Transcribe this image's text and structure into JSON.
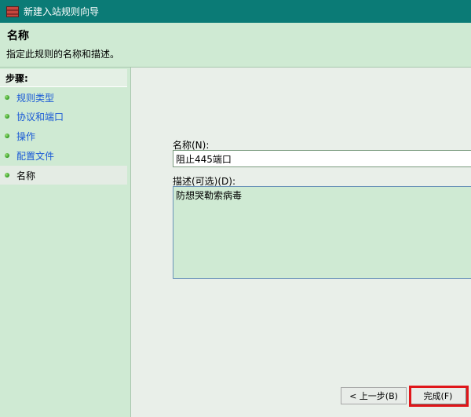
{
  "window": {
    "title": "新建入站规则向导",
    "icon": "firewall-icon"
  },
  "header": {
    "title": "名称",
    "subtitle": "指定此规则的名称和描述。"
  },
  "sidebar": {
    "steps_label": "步骤:",
    "items": [
      {
        "label": "规则类型"
      },
      {
        "label": "协议和端口"
      },
      {
        "label": "操作"
      },
      {
        "label": "配置文件"
      },
      {
        "label": "名称"
      }
    ]
  },
  "form": {
    "name_label": "名称(N):",
    "name_value": "阻止445端口",
    "desc_label": "描述(可选)(D):",
    "desc_value": "防想哭勒索病毒"
  },
  "buttons": {
    "back": "< 上一步(B)",
    "finish": "完成(F)"
  },
  "colors": {
    "titlebar": "#0b7b76",
    "link": "#1a5ad6",
    "highlight": "#e0161a",
    "panel": "#cfead3"
  }
}
